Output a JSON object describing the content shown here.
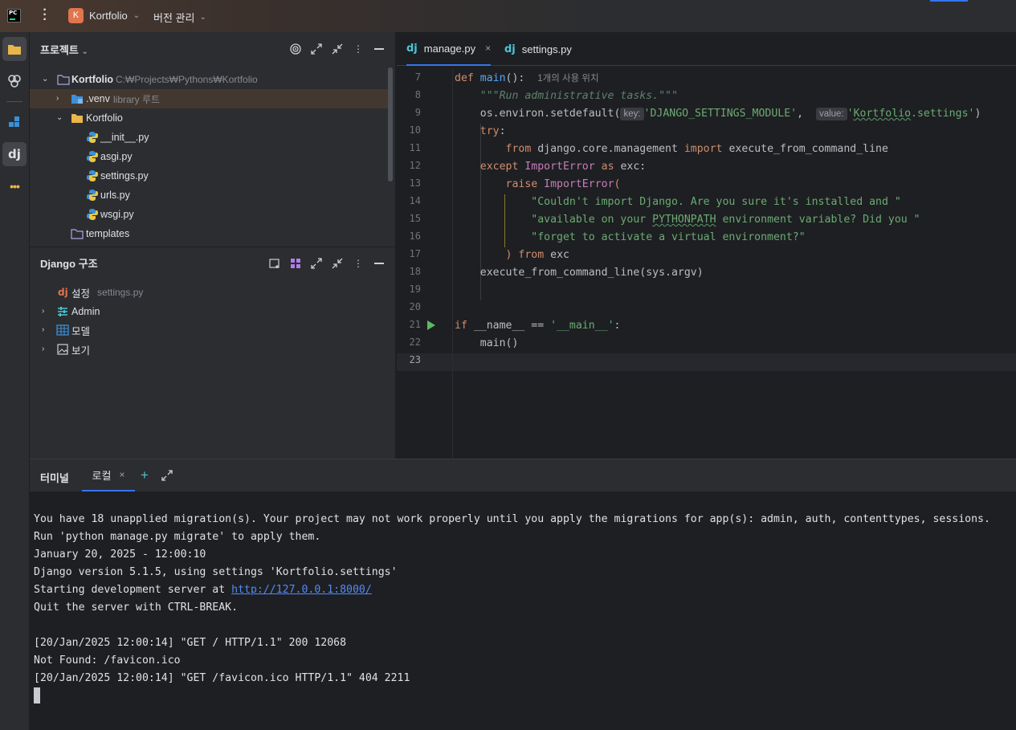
{
  "titlebar": {
    "app_icon": "PC",
    "project_badge": "K",
    "project_name": "Kortfolio",
    "vcs_label": "버전 관리"
  },
  "activity_bar": {
    "items": [
      "folder-icon",
      "plugins-icon",
      "structure-icon",
      "django-icon",
      "more-icon"
    ]
  },
  "project_panel": {
    "title": "프로젝트",
    "tree": [
      {
        "label": "Kortfolio",
        "path": "C:₩Projects₩Pythons₩Kortfolio",
        "level": 0,
        "expanded": true
      },
      {
        "label": ".venv",
        "hint": "library 루트",
        "level": 1,
        "expanded": false
      },
      {
        "label": "Kortfolio",
        "level": 1,
        "expanded": true
      },
      {
        "label": "__init__.py",
        "level": 2
      },
      {
        "label": "asgi.py",
        "level": 2
      },
      {
        "label": "settings.py",
        "level": 2
      },
      {
        "label": "urls.py",
        "level": 2
      },
      {
        "label": "wsgi.py",
        "level": 2
      },
      {
        "label": "templates",
        "level": 1
      }
    ]
  },
  "django_panel": {
    "title": "Django 구조",
    "items": [
      {
        "label": "설정",
        "hint": "settings.py"
      },
      {
        "label": "Admin"
      },
      {
        "label": "모델"
      },
      {
        "label": "보기"
      }
    ]
  },
  "editor": {
    "tabs": [
      {
        "prefix": "dj",
        "label": "manage.py",
        "active": true,
        "close": "×"
      },
      {
        "prefix": "dj",
        "label": "settings.py",
        "active": false
      }
    ],
    "line_numbers": [
      "7",
      "8",
      "9",
      "10",
      "11",
      "12",
      "13",
      "14",
      "15",
      "16",
      "17",
      "18",
      "19",
      "20",
      "21",
      "22",
      "23"
    ],
    "usage_hint": "1개의 사용 위치",
    "hint_key": "key:",
    "hint_value": "value:",
    "tokens": {
      "l7_kw": "def",
      "l7_fn": "main",
      "l7_rest": "():",
      "l8": "\"\"\"Run administrative tasks.\"\"\"",
      "l9_a": "os.environ.setdefault(",
      "l9_s1": "'DJANGO_SETTINGS_MODULE'",
      "l9_comma": ", ",
      "l9_q": "'",
      "l9_wavy": "Kortfolio",
      "l9_s2rest": ".settings'",
      "l9_end": ")",
      "l10_kw": "try",
      "l10_rest": ":",
      "l11_kw1": "from",
      "l11_mid": " django.core.management ",
      "l11_kw2": "import",
      "l11_rest": " execute_from_command_line",
      "l12_kw": "except",
      "l12_cls": " ImportError ",
      "l12_kw2": "as",
      "l12_rest": " exc:",
      "l13_kw": "raise",
      "l13_cls": " ImportError",
      "l13_rest": "(",
      "l14": "\"Couldn't import Django. Are you sure it's installed and \"",
      "l15_a": "\"available on your ",
      "l15_w": "PYTHONPATH",
      "l15_b": " environment variable? Did you \"",
      "l16": "\"forget to activate a virtual environment?\"",
      "l17_a": ")",
      "l17_kw": " from",
      "l17_rest": " exc",
      "l18": "execute_from_command_line(sys.argv)",
      "l21_kw": "if",
      "l21_mid": " __name__ == ",
      "l21_s": "'__main__'",
      "l21_rest": ":",
      "l22": "main()"
    }
  },
  "terminal": {
    "title": "터미널",
    "tab_label": "로컬",
    "tab_close": "×",
    "add": "+",
    "lines": [
      "You have 18 unapplied migration(s). Your project may not work properly until you apply the migrations for app(s): admin, auth, contenttypes, sessions.",
      "Run 'python manage.py migrate' to apply them.",
      "January 20, 2025 - 12:00:10",
      "Django version 5.1.5, using settings 'Kortfolio.settings'",
      "Starting development server at ",
      "Quit the server with CTRL-BREAK.",
      "",
      "[20/Jan/2025 12:00:14] \"GET / HTTP/1.1\" 200 12068",
      "Not Found: /favicon.ico",
      "[20/Jan/2025 12:00:14] \"GET /favicon.ico HTTP/1.1\" 404 2211"
    ],
    "server_link": "http://127.0.0.1:8000/"
  },
  "colors": {
    "accent": "#3574f0",
    "keyword": "#cf8e6d",
    "function": "#56a8f5",
    "string": "#6aab73",
    "link": "#548af7"
  }
}
